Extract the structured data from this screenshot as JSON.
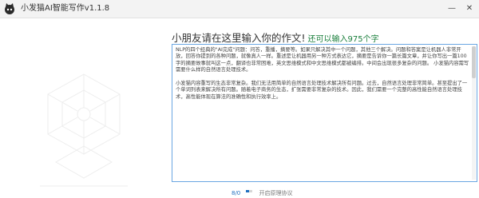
{
  "window": {
    "title": "小发猫AI智能写作v1.1.8",
    "min_glyph": "—",
    "close_glyph": "✕",
    "logo_icon": "cat-logo-icon"
  },
  "prompt": {
    "headline": "小朋友请在这里输入你的作文!",
    "remaining_hint": "还可以输入975个字",
    "remaining_count": 975
  },
  "editor": {
    "paragraphs": [
      "NLP的四个经典的\"AI完成\"问题：问答，重播，摘要等。如果只解决其中一个问题，其他三个解决。问题和答案是让机器人非常开放，回答你提到的各种问题，就像真人一样。重述是让机器用另一种方式表达它，摘要是告诉你一篇长篇文章，并让你写出一篇100字的摘要故事就叫这一点，翻译也非常困难，英文思维模式和中文思维模式都被编排。中间会出现很多复杂的问题。 小发猫内容需写需要什么样的自然语言处理技术。",
      "小发猫内容重写的生态非常复杂。我们无法用简单的自然语言处理技术解决所有问题。过去，自然语言处理非常简单。甚至提出了一个单词列表来解决所有问题。随着电子商务的生态，扩张需要非常复杂的技术。因此，我们需要一个完整的高性能自然语言处理技术，高性能体现在算法的准确性和执行效率上。"
    ]
  },
  "footer": {
    "counter": "8/0",
    "progress_fraction": 0.5,
    "agreement": "开启原理协议"
  },
  "colors": {
    "accent_blue": "#1f6fc0",
    "hint_green": "#1a7f3c",
    "editor_border": "#6aa6e2"
  }
}
